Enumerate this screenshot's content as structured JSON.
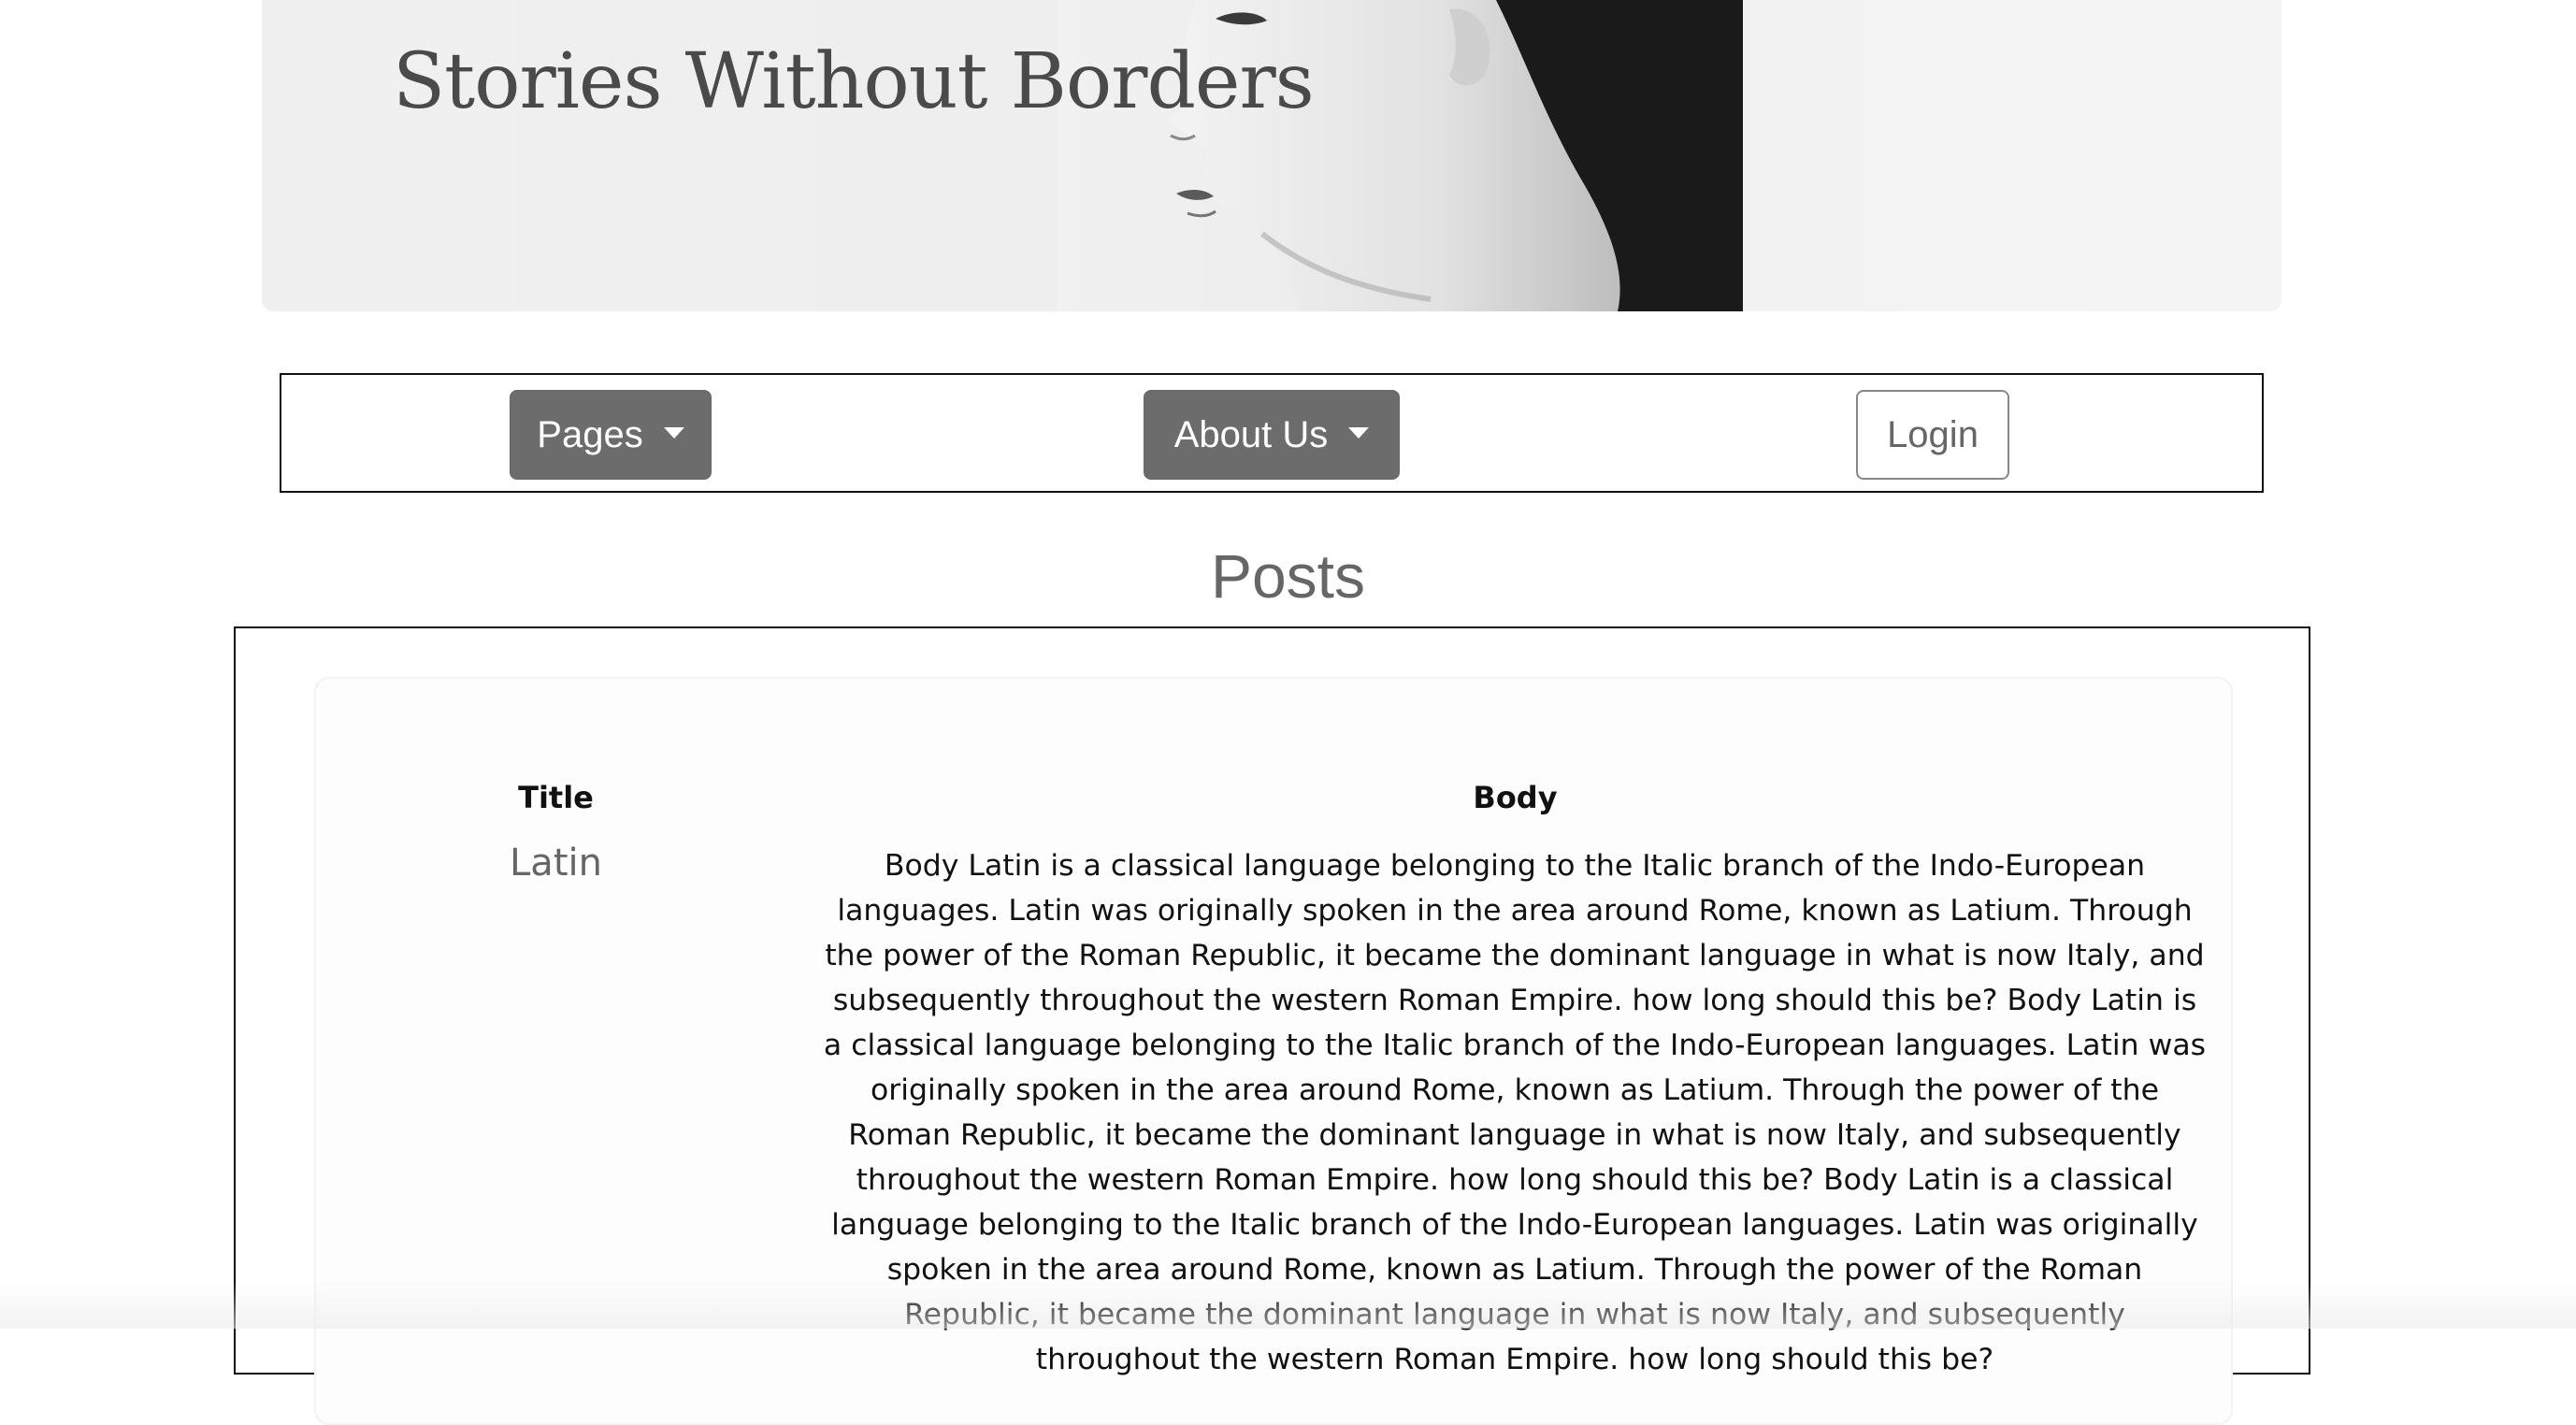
{
  "header": {
    "site_title": "Stories Without Borders"
  },
  "nav": {
    "pages_label": "Pages",
    "about_label": "About Us",
    "login_label": "Login"
  },
  "posts": {
    "heading": "Posts",
    "columns": {
      "title": "Title",
      "body": "Body"
    },
    "rows": [
      {
        "title": "Latin",
        "body": "Body Latin is a classical language belonging to the Italic branch of the Indo-European languages. Latin was originally spoken in the area around Rome, known as Latium. Through the power of the Roman Republic, it became the dominant language in what is now Italy, and subsequently throughout the western Roman Empire. how long should this be? Body Latin is a classical language belonging to the Italic branch of the Indo-European languages. Latin was originally spoken in the area around Rome, known as Latium. Through the power of the Roman Republic, it became the dominant language in what is now Italy, and subsequently throughout the western Roman Empire. how long should this be? Body Latin is a classical language belonging to the Italic branch of the Indo-European languages. Latin was originally spoken in the area around Rome, known as Latium. Through the power of the Roman Republic, it became the dominant language in what is now Italy, and subsequently throughout the western Roman Empire. how long should this be?"
      }
    ]
  },
  "colors": {
    "button_dark": "#6c6c6c",
    "title_text": "#4a4a4a",
    "muted_text": "#666666",
    "border": "#111111"
  }
}
